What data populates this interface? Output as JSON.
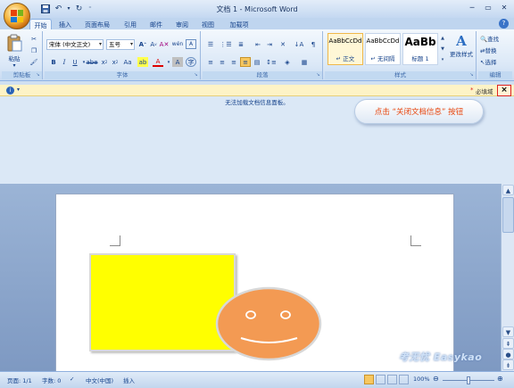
{
  "window": {
    "title": "文档 1 - Microsoft Word"
  },
  "tabs": [
    "开始",
    "插入",
    "页面布局",
    "引用",
    "邮件",
    "审阅",
    "视图",
    "加载项"
  ],
  "active_tab": "开始",
  "ribbon": {
    "clipboard": {
      "paste_label": "粘贴",
      "group_label": "剪贴板"
    },
    "font": {
      "font_name": "宋体 (中文正文)",
      "font_size": "五号",
      "group_label": "字体"
    },
    "paragraph": {
      "group_label": "段落"
    },
    "styles": {
      "group_label": "样式",
      "items": [
        {
          "sample": "AaBbCcDd",
          "name": "↵ 正文"
        },
        {
          "sample": "AaBbCcDd",
          "name": "↵ 无间隔"
        },
        {
          "sample": "AaBb",
          "name": "标题 1"
        }
      ],
      "change_styles_label": "更改样式"
    },
    "editing": {
      "find": "查找",
      "replace": "替换",
      "select": "选择",
      "group_label": "编辑"
    }
  },
  "doc_info": {
    "required_field": "必填域",
    "message": "无法加载文档信息面板。"
  },
  "callout": {
    "text": "点击 “关闭文档信息” 按钮"
  },
  "status": {
    "page": "页面: 1/1",
    "words": "字数: 0",
    "language": "中文(中国)",
    "mode": "插入",
    "zoom": "100%"
  },
  "watermark": "考无忧 Easykao",
  "colors": {
    "rectangle": "#ffff00",
    "face": "#f39a53",
    "callout_text": "#e8460e"
  }
}
